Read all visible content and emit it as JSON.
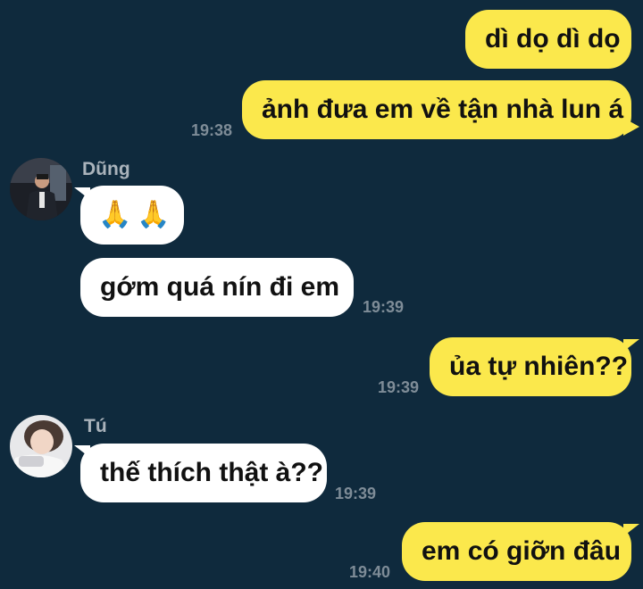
{
  "colors": {
    "background": "#0f2a3d",
    "outgoing_bubble": "#fbe84c",
    "incoming_bubble": "#ffffff",
    "timestamp": "#7e8c97",
    "sender_name": "#aab3bb"
  },
  "messages": {
    "m1": {
      "text": "dì dọ dì dọ"
    },
    "m2": {
      "text": "ảnh đưa em về tận nhà lun á",
      "time": "19:38"
    },
    "dung": {
      "sender": "Dũng",
      "avatar_icon": "person-photo-icon",
      "m3": {
        "emoji": "🙏🙏"
      },
      "m4": {
        "text": "gớm quá nín đi em",
        "time": "19:39"
      }
    },
    "m5": {
      "text": "ủa tự nhiên??",
      "time": "19:39"
    },
    "tu": {
      "sender": "Tú",
      "avatar_icon": "person-photo-icon",
      "m6": {
        "text": "thế thích thật à??",
        "time": "19:39"
      }
    },
    "m7": {
      "text": "em có giỡn đâu",
      "time": "19:40"
    }
  }
}
